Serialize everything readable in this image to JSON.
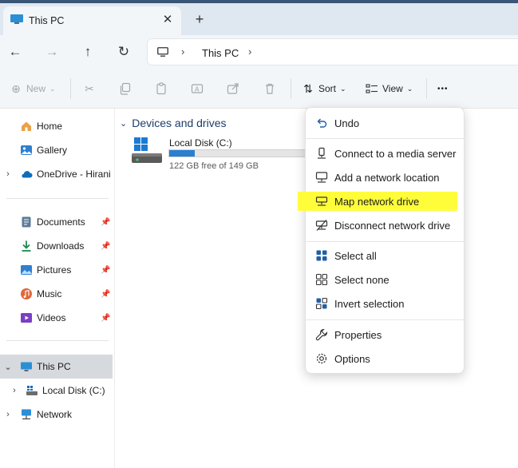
{
  "tabs": [
    {
      "label": "This PC",
      "active": true
    }
  ],
  "tab_close_glyph": "✕",
  "tab_add_glyph": "+",
  "nav": {
    "back_glyph": "←",
    "forward_glyph": "→",
    "up_glyph": "↑",
    "refresh_glyph": "↻",
    "breadcrumb": [
      "This PC"
    ],
    "chevron_glyph": "›"
  },
  "toolbar": {
    "new_label": "New",
    "sort_label": "Sort",
    "view_label": "View",
    "more_glyph": "•••"
  },
  "sidebar": {
    "items": [
      {
        "label": "Home",
        "icon": "home-icon"
      },
      {
        "label": "Gallery",
        "icon": "gallery-icon"
      },
      {
        "label": "OneDrive - Hirani E",
        "icon": "cloud-icon"
      },
      {
        "label": "Documents",
        "icon": "documents-icon"
      },
      {
        "label": "Downloads",
        "icon": "downloads-icon"
      },
      {
        "label": "Pictures",
        "icon": "pictures-icon"
      },
      {
        "label": "Music",
        "icon": "music-icon"
      },
      {
        "label": "Videos",
        "icon": "videos-icon"
      },
      {
        "label": "This PC",
        "icon": "pc-icon",
        "selected": true
      },
      {
        "label": "Local Disk (C:)",
        "icon": "drive-icon"
      },
      {
        "label": "Network",
        "icon": "network-icon"
      }
    ],
    "pin_glyph": "📌"
  },
  "main": {
    "group_title": "Devices and drives",
    "drives": [
      {
        "name": "Local Disk (C:)",
        "free_text": "122 GB free of 149 GB",
        "used_fraction": 0.18
      }
    ]
  },
  "context_menu": {
    "items": [
      {
        "label": "Undo",
        "icon": "undo-icon"
      },
      {
        "label": "Connect to a media server",
        "icon": "media-server-icon"
      },
      {
        "label": "Add a network location",
        "icon": "network-location-icon"
      },
      {
        "label": "Map network drive",
        "icon": "map-drive-icon",
        "highlighted": true
      },
      {
        "label": "Disconnect network drive",
        "icon": "disconnect-drive-icon"
      },
      {
        "label": "Select all",
        "icon": "select-all-icon"
      },
      {
        "label": "Select none",
        "icon": "select-none-icon"
      },
      {
        "label": "Invert selection",
        "icon": "invert-selection-icon"
      },
      {
        "label": "Properties",
        "icon": "properties-icon"
      },
      {
        "label": "Options",
        "icon": "options-icon"
      }
    ]
  },
  "colors": {
    "accent": "#2a7fd0",
    "highlight": "#fffd3a",
    "selected_bg": "#d6d9dd"
  }
}
